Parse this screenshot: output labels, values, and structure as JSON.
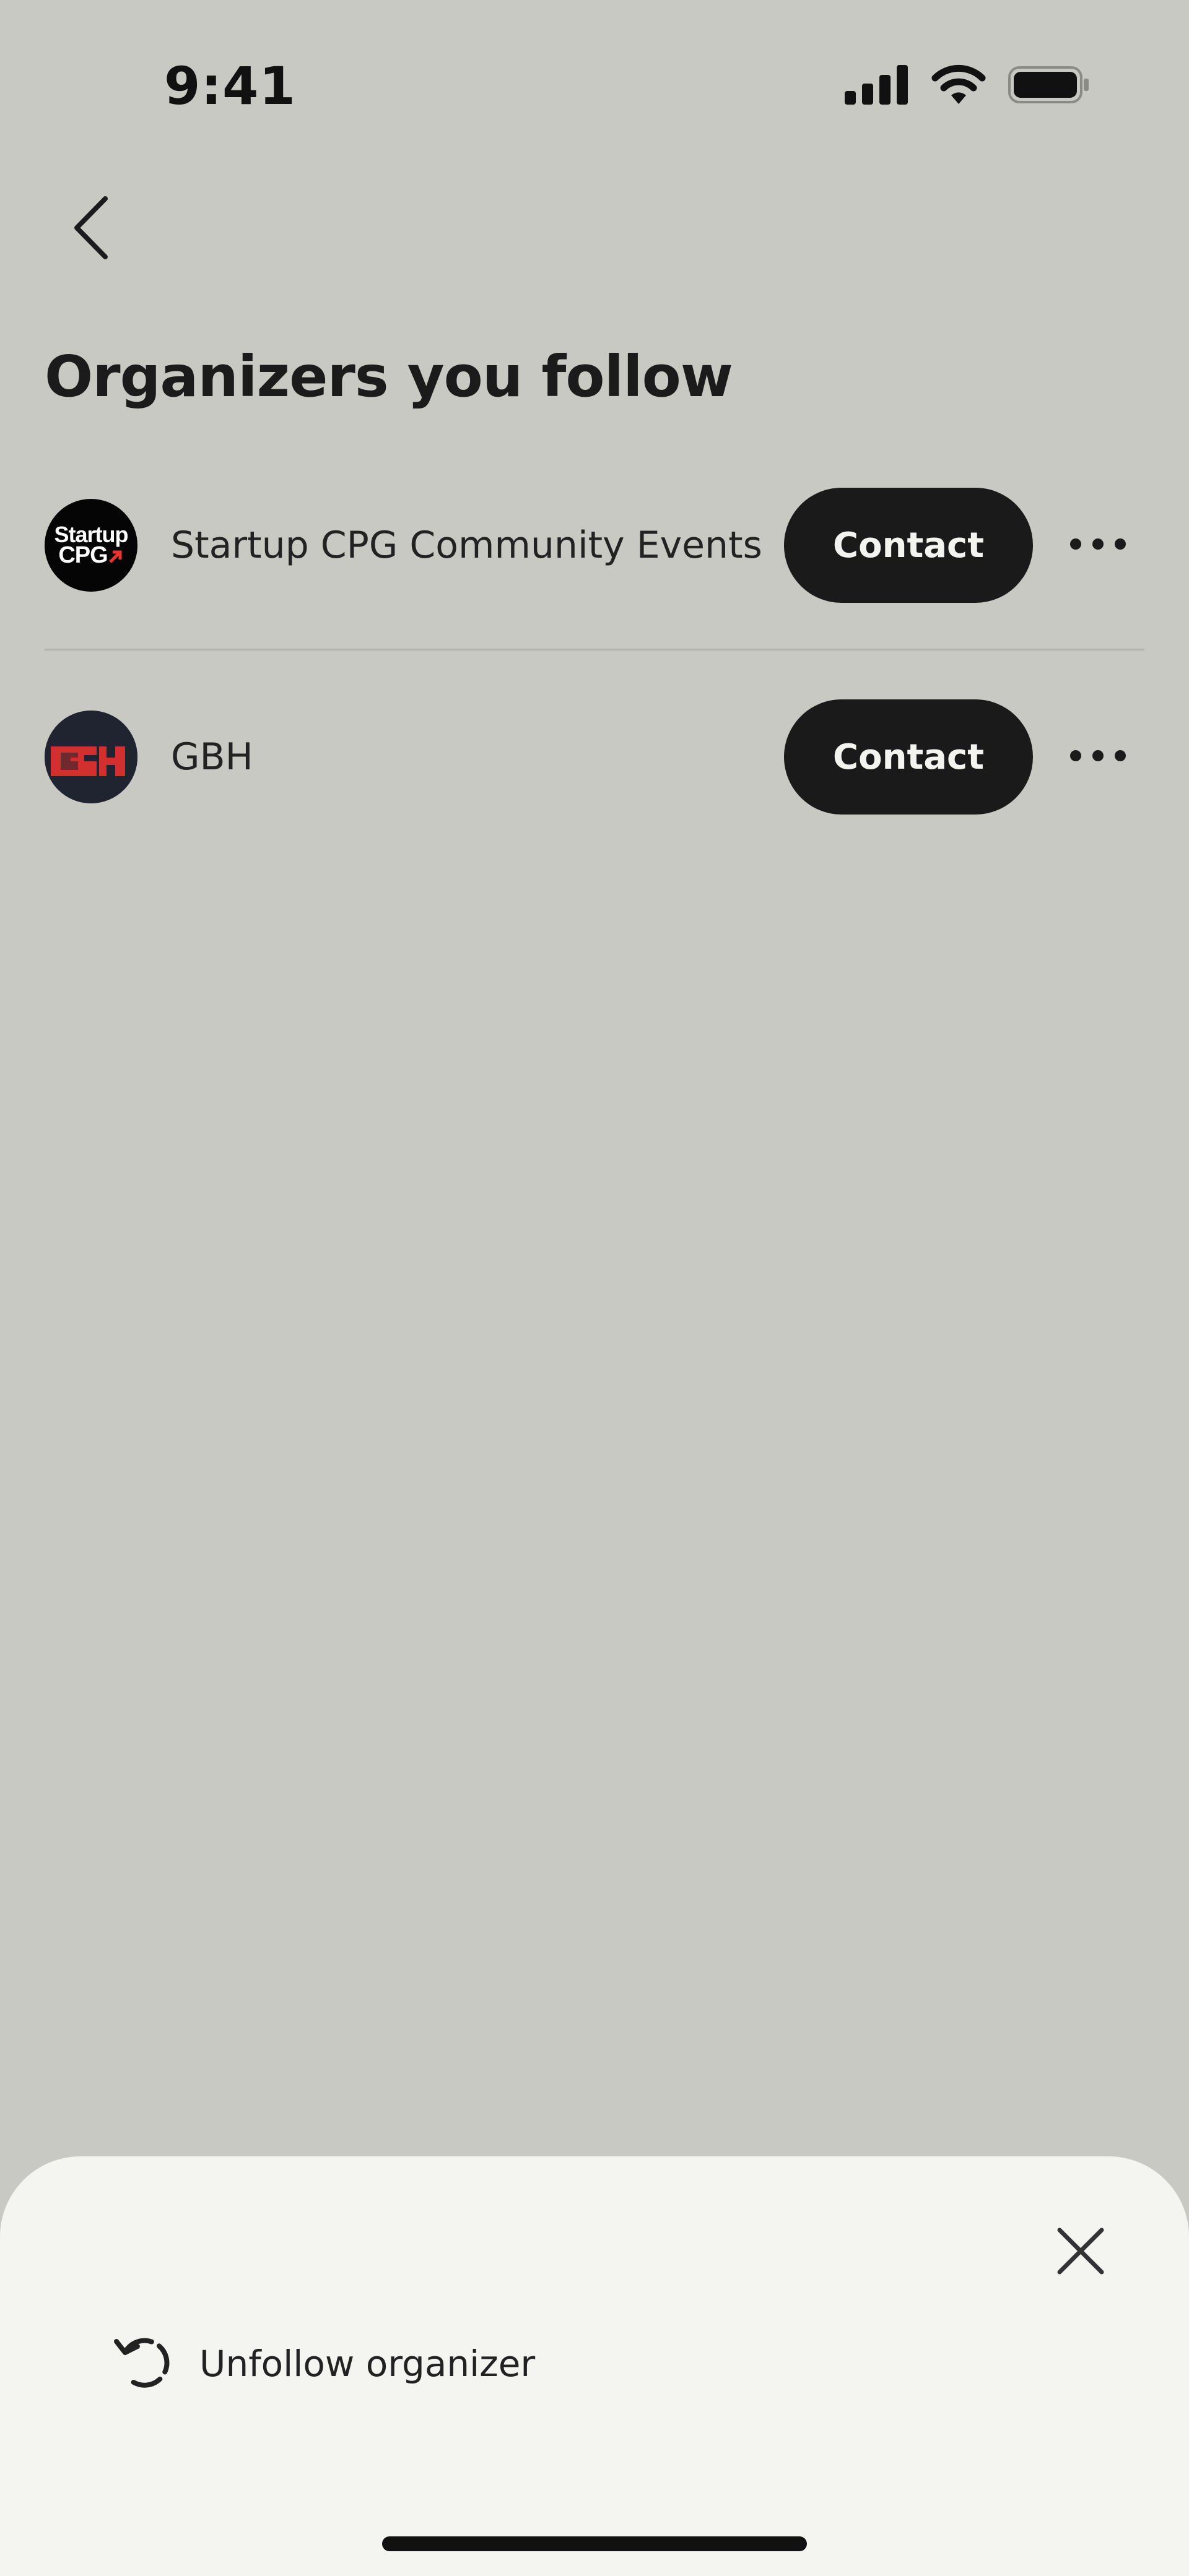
{
  "status_bar": {
    "time": "9:41",
    "icons": [
      "cellular-signal-icon",
      "wifi-icon",
      "battery-icon"
    ]
  },
  "header": {
    "back_icon": "chevron-left-icon",
    "title": "Organizers you follow"
  },
  "organizers": [
    {
      "name": "Startup CPG Community Events",
      "avatar_text_line1": "Startup",
      "avatar_text_line2": "CPG",
      "contact_label": "Contact",
      "more_icon": "more-horizontal-icon"
    },
    {
      "name": "GBH",
      "contact_label": "Contact",
      "more_icon": "more-horizontal-icon"
    }
  ],
  "bottom_sheet": {
    "close_icon": "close-icon",
    "action_icon": "undo-icon",
    "action_label": "Unfollow organizer"
  },
  "colors": {
    "background_dimmed": "#c9c9c4",
    "sheet_background": "#f4f5f1",
    "button_dark": "#1a1a1a",
    "text_primary": "#1b1b1b",
    "accent_red": "#d2302f"
  }
}
